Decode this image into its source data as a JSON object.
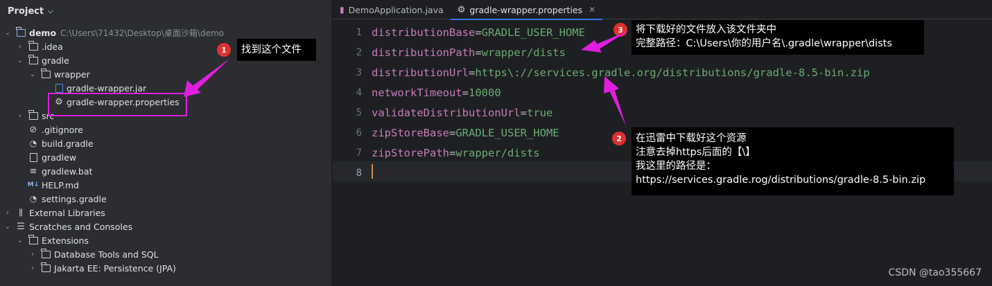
{
  "project_panel": {
    "title": "Project",
    "tree": [
      {
        "label": "demo",
        "path": "C:\\Users\\71432\\Desktop\\桌面沙箱\\demo",
        "icon": "module-folder-icon"
      },
      {
        "label": ".idea",
        "icon": "folder-icon"
      },
      {
        "label": "gradle",
        "icon": "folder-icon"
      },
      {
        "label": "wrapper",
        "icon": "folder-icon"
      },
      {
        "label": "gradle-wrapper.jar",
        "icon": "jar-file-icon"
      },
      {
        "label": "gradle-wrapper.properties",
        "icon": "properties-file-icon"
      },
      {
        "label": "src",
        "icon": "folder-icon"
      },
      {
        "label": ".gitignore",
        "icon": "gitignore-icon"
      },
      {
        "label": "build.gradle",
        "icon": "gradle-icon"
      },
      {
        "label": "gradlew",
        "icon": "file-icon"
      },
      {
        "label": "gradlew.bat",
        "icon": "text-file-icon"
      },
      {
        "label": "HELP.md",
        "icon": "markdown-icon"
      },
      {
        "label": "settings.gradle",
        "icon": "gradle-icon"
      },
      {
        "label": "External Libraries",
        "icon": "libraries-icon"
      },
      {
        "label": "Scratches and Consoles",
        "icon": "scratches-icon"
      },
      {
        "label": "Extensions",
        "icon": "folder-icon"
      },
      {
        "label": "Database Tools and SQL",
        "icon": "folder-icon"
      },
      {
        "label": "Jakarta EE: Persistence (JPA)",
        "icon": "folder-icon"
      }
    ]
  },
  "tabs": [
    {
      "label": "DemoApplication.java",
      "icon": "java-file-icon"
    },
    {
      "label": "gradle-wrapper.properties",
      "icon": "properties-file-icon",
      "close": "✕"
    }
  ],
  "editor": {
    "line_numbers": [
      "1",
      "2",
      "3",
      "4",
      "5",
      "6",
      "7",
      "8"
    ],
    "lines": [
      {
        "key": "distributionBase",
        "eq": "=",
        "value": "GRADLE_USER_HOME"
      },
      {
        "key": "distributionPath",
        "eq": "=",
        "value": "wrapper/dists"
      },
      {
        "key": "distributionUrl",
        "eq": "=",
        "value": "https\\://services.gradle.org/distributions/gradle-8.5-bin.zip"
      },
      {
        "key": "networkTimeout",
        "eq": "=",
        "value": "10000"
      },
      {
        "key": "validateDistributionUrl",
        "eq": "=",
        "value": "true"
      },
      {
        "key": "zipStoreBase",
        "eq": "=",
        "value": "GRADLE_USER_HOME"
      },
      {
        "key": "zipStorePath",
        "eq": "=",
        "value": "wrapper/dists"
      },
      {
        "key": "",
        "eq": "",
        "value": ""
      }
    ]
  },
  "annotations": {
    "callout1": {
      "badge": "1",
      "text": "找到这个文件"
    },
    "callout2": {
      "badge": "2",
      "lines": [
        "在迅雷中下载好这个资源",
        "注意去掉https后面的【\\】",
        "我这里的路径是：",
        "https://services.gradle.rog/distributions/gradle-8.5-bin.zip"
      ]
    },
    "callout3": {
      "badge": "3",
      "lines": [
        "将下载好的文件放入该文件夹中",
        "完整路径：C:\\Users\\你的用户名\\.gradle\\wrapper\\dists"
      ]
    },
    "accent_color": "#e01ee0",
    "badge_color": "#e03030"
  },
  "watermark": "CSDN @tao355667"
}
